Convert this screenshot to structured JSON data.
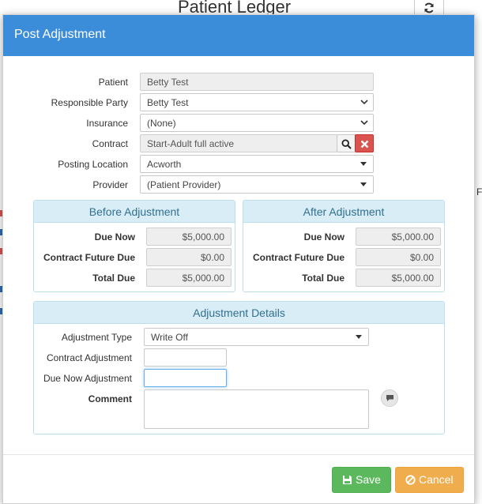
{
  "background": {
    "page_title": "Patient Ledger",
    "right_letter": "F"
  },
  "modal": {
    "title": "Post Adjustment"
  },
  "form": {
    "patient": {
      "label": "Patient",
      "value": "Betty Test"
    },
    "responsible_party": {
      "label": "Responsible Party",
      "value": "Betty Test"
    },
    "insurance": {
      "label": "Insurance",
      "value": "(None)"
    },
    "contract": {
      "label": "Contract",
      "value": "Start-Adult full active"
    },
    "posting_location": {
      "label": "Posting Location",
      "value": "Acworth"
    },
    "provider": {
      "label": "Provider",
      "value": "(Patient Provider)"
    }
  },
  "before": {
    "title": "Before Adjustment",
    "rows": [
      {
        "label": "Due Now",
        "value": "$5,000.00"
      },
      {
        "label": "Contract Future Due",
        "value": "$0.00"
      },
      {
        "label": "Total Due",
        "value": "$5,000.00"
      }
    ]
  },
  "after": {
    "title": "After Adjustment",
    "rows": [
      {
        "label": "Due Now",
        "value": "$5,000.00"
      },
      {
        "label": "Contract Future Due",
        "value": "$0.00"
      },
      {
        "label": "Total Due",
        "value": "$5,000.00"
      }
    ]
  },
  "details": {
    "title": "Adjustment Details",
    "adjustment_type": {
      "label": "Adjustment Type",
      "value": "Write Off"
    },
    "contract_adjustment": {
      "label": "Contract Adjustment",
      "value": ""
    },
    "due_now_adjustment": {
      "label": "Due Now Adjustment",
      "value": ""
    },
    "comment": {
      "label": "Comment",
      "value": ""
    }
  },
  "buttons": {
    "save": "Save",
    "cancel": "Cancel"
  },
  "colors": {
    "header": "#3c8dd9",
    "panel_head": "#d9edf7",
    "panel_text": "#31708f",
    "save": "#5cb85c",
    "cancel": "#f0ad4e",
    "danger": "#d9534f"
  },
  "icons": {
    "refresh": "refresh-icon",
    "search": "search-icon",
    "clear": "clear-icon",
    "save": "floppy-disk-icon",
    "cancel": "ban-icon",
    "comment": "comment-icon"
  }
}
